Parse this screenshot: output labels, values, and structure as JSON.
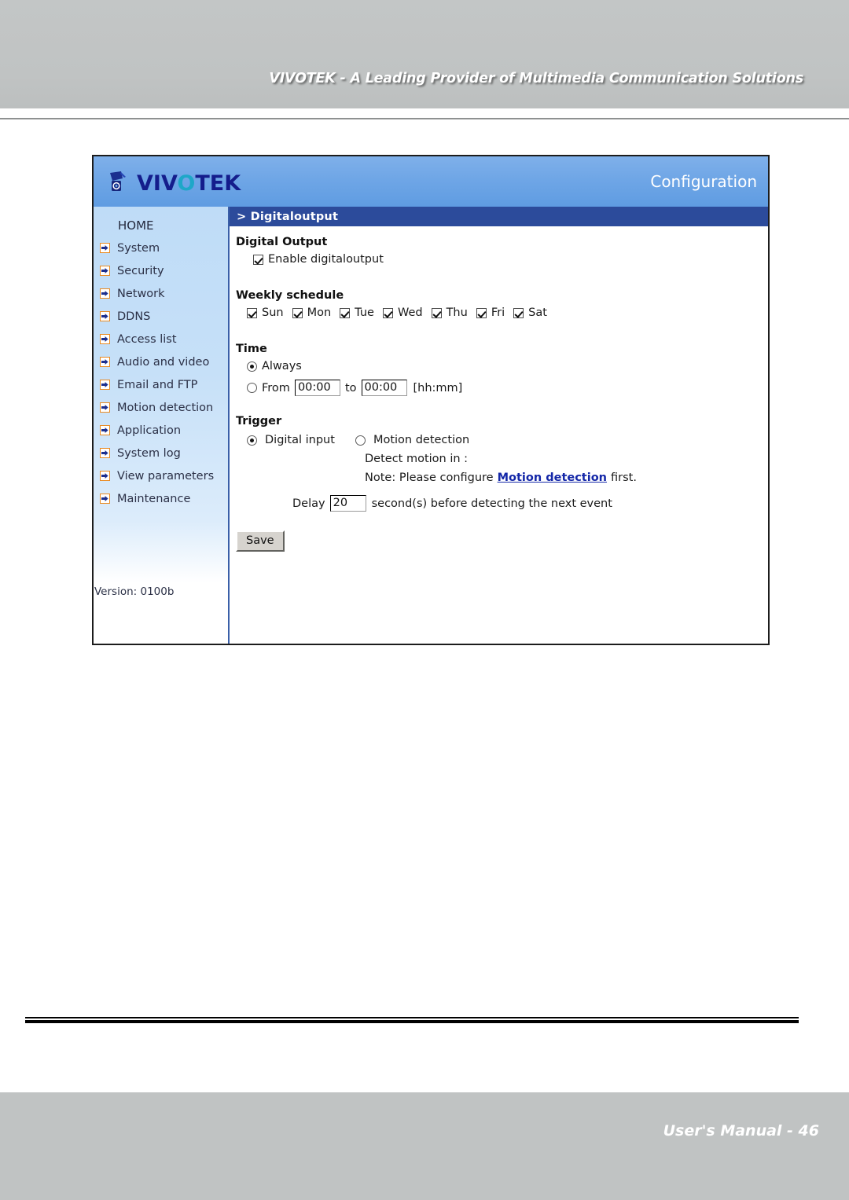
{
  "document": {
    "header_title": "VIVOTEK - A Leading Provider of Multimedia Communication Solutions",
    "footer_title": "User's Manual - 46"
  },
  "colors": {
    "accent_blue": "#2c4b9b",
    "topbar_blue": "#6fa6e6",
    "sidebar_blue": "#c6e0f8",
    "link_blue": "#1427a8",
    "arrow_orange": "#e88a22",
    "band_gray": "#c0c3c3"
  },
  "panel": {
    "brand": {
      "logo_icon": "camera-logo-icon",
      "name_part1": "VIV",
      "name_o": "O",
      "name_part2": "TEK"
    },
    "config_label": "Configuration",
    "content_title": "> Digitaloutput"
  },
  "sidebar": {
    "items": [
      {
        "label": "HOME",
        "icon": "none"
      },
      {
        "label": "System",
        "icon": "arrow-right-icon"
      },
      {
        "label": "Security",
        "icon": "arrow-right-icon"
      },
      {
        "label": "Network",
        "icon": "arrow-right-icon"
      },
      {
        "label": "DDNS",
        "icon": "arrow-right-icon"
      },
      {
        "label": "Access list",
        "icon": "arrow-right-icon"
      },
      {
        "label": "Audio and video",
        "icon": "arrow-right-icon"
      },
      {
        "label": "Email and FTP",
        "icon": "arrow-right-icon"
      },
      {
        "label": "Motion detection",
        "icon": "arrow-right-icon"
      },
      {
        "label": "Application",
        "icon": "arrow-right-icon"
      },
      {
        "label": "System log",
        "icon": "arrow-right-icon"
      },
      {
        "label": "View parameters",
        "icon": "arrow-right-icon"
      },
      {
        "label": "Maintenance",
        "icon": "arrow-right-icon"
      }
    ],
    "version": "Version: 0100b"
  },
  "form": {
    "digital_output": {
      "heading": "Digital Output",
      "enable_label": "Enable digitaloutput",
      "enable_checked": true
    },
    "weekly_schedule": {
      "heading": "Weekly schedule",
      "days": [
        {
          "label": "Sun",
          "checked": true
        },
        {
          "label": "Mon",
          "checked": true
        },
        {
          "label": "Tue",
          "checked": true
        },
        {
          "label": "Wed",
          "checked": true
        },
        {
          "label": "Thu",
          "checked": true
        },
        {
          "label": "Fri",
          "checked": true
        },
        {
          "label": "Sat",
          "checked": true
        }
      ]
    },
    "time": {
      "heading": "Time",
      "always_label": "Always",
      "always_selected": true,
      "from_label": "From",
      "from_selected": false,
      "from_value": "00:00",
      "to_label": "to",
      "to_value": "00:00",
      "format_label": "[hh:mm]"
    },
    "trigger": {
      "heading": "Trigger",
      "digital_input_label": "Digital input",
      "digital_input_selected": true,
      "motion_detection_label": "Motion detection",
      "motion_detection_selected": false,
      "detect_motion_label": "Detect motion in :",
      "note_prefix": "Note: Please configure",
      "note_link": "Motion detection",
      "note_suffix": "first.",
      "delay_label": "Delay",
      "delay_value": "20",
      "delay_suffix": "second(s) before detecting the next event"
    },
    "save_label": "Save"
  }
}
